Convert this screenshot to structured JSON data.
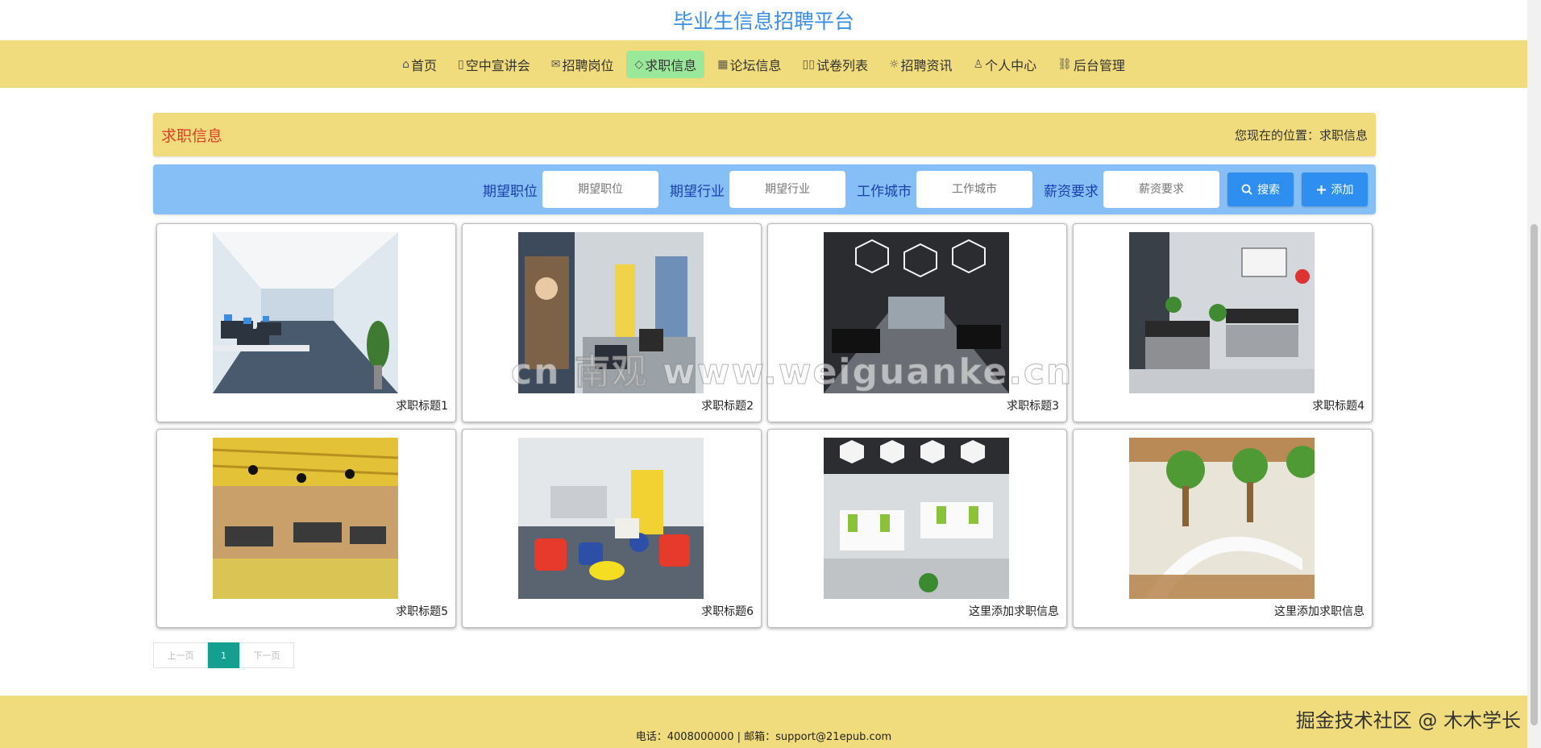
{
  "site": {
    "title": "毕业生信息招聘平台"
  },
  "nav": [
    {
      "icon": "home-icon",
      "glyph": "⌂",
      "label": "首页",
      "active": false
    },
    {
      "icon": "note-icon",
      "glyph": "▯",
      "label": "空中宣讲会",
      "active": false
    },
    {
      "icon": "mail-icon",
      "glyph": "✉",
      "label": "招聘岗位",
      "active": false
    },
    {
      "icon": "tag-icon",
      "glyph": "◇",
      "label": "求职信息",
      "active": true
    },
    {
      "icon": "grid-icon",
      "glyph": "▦",
      "label": "论坛信息",
      "active": false
    },
    {
      "icon": "book-icon",
      "glyph": "▯▯",
      "label": "试卷列表",
      "active": false
    },
    {
      "icon": "sun-icon",
      "glyph": "☼",
      "label": "招聘资讯",
      "active": false
    },
    {
      "icon": "user-icon",
      "glyph": "♙",
      "label": "个人中心",
      "active": false
    },
    {
      "icon": "link-icon",
      "glyph": "⛓",
      "label": "后台管理",
      "active": false
    }
  ],
  "breadcrumb": {
    "title": "求职信息",
    "location": "您现在的位置：求职信息"
  },
  "search": {
    "fields": [
      {
        "label": "期望职位",
        "placeholder": "期望职位"
      },
      {
        "label": "期望行业",
        "placeholder": "期望行业"
      },
      {
        "label": "工作城市",
        "placeholder": "工作城市"
      },
      {
        "label": "薪资要求",
        "placeholder": "薪资要求"
      }
    ],
    "search_label": "搜索",
    "add_label": "添加"
  },
  "cards": [
    {
      "caption": "求职标题1",
      "scene": "bright office corridor with computer desks"
    },
    {
      "caption": "求职标题2",
      "scene": "modern office lounge with wall poster"
    },
    {
      "caption": "求职标题3",
      "scene": "dark office with hexagonal ceiling lights"
    },
    {
      "caption": "求职标题4",
      "scene": "office with desks and calligraphy wall"
    },
    {
      "caption": "求职标题5",
      "scene": "open office with yellow wooden ceiling"
    },
    {
      "caption": "求职标题6",
      "scene": "colorful lounge with stools and poufs"
    },
    {
      "caption": "这里添加求职信息",
      "scene": "open office with green workstations"
    },
    {
      "caption": "这里添加求职信息",
      "scene": "office with indoor trees and white desk"
    }
  ],
  "pagination": {
    "prev": "上一页",
    "current": "1",
    "next": "下一页"
  },
  "footer": {
    "contact": "电话：4008000000 | 邮箱：support@21epub.com"
  },
  "watermark": "cn 南观 www.weiguanke.cn",
  "corner_mark": "掘金技术社区 @ 木木学长"
}
